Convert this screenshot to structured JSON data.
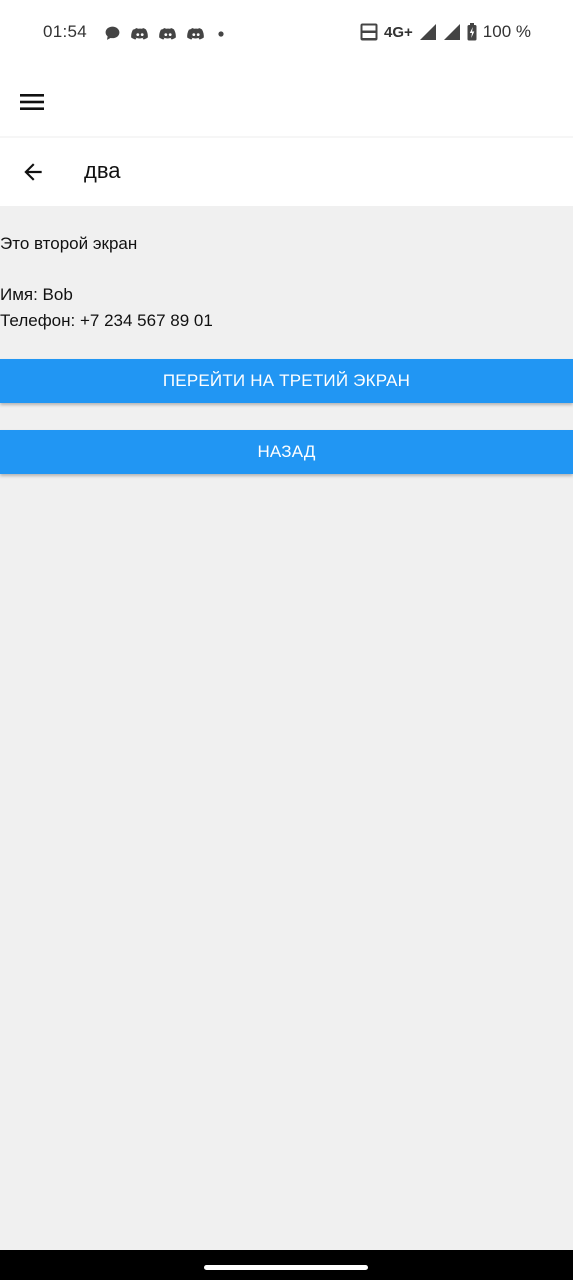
{
  "status_bar": {
    "time": "01:54",
    "network": "4G+",
    "battery": "100 %",
    "icons": [
      "chat-bubble-icon",
      "discord-icon",
      "discord-icon",
      "discord-icon",
      "dot-icon",
      "volte-icon",
      "signal-icon",
      "signal-icon",
      "battery-charging-icon"
    ]
  },
  "app_bar": {
    "menu_icon": "hamburger-menu-icon"
  },
  "nav_bar": {
    "back_icon": "arrow-back-icon",
    "title": "два"
  },
  "screen": {
    "heading": "Это второй экран",
    "name_line": "Имя: Bob",
    "phone_line": "Телефон: +7 234 567 89 01"
  },
  "buttons": {
    "next_label": "ПЕРЕЙТИ НА ТРЕТИЙ ЭКРАН",
    "back_label": "НАЗАД"
  },
  "colors": {
    "accent": "#2196f3",
    "background": "#f0f0f0"
  }
}
